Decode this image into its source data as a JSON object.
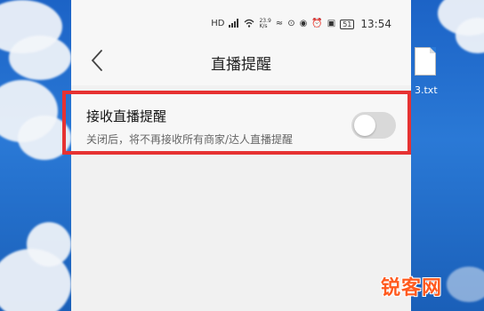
{
  "statusbar": {
    "icons": [
      "hd-icon",
      "signal-icon",
      "wifi-icon",
      "speed-icon",
      "nfc-icon",
      "screen-icon",
      "eye-icon",
      "alarm-icon",
      "battery-icon"
    ],
    "network_speed": "23.9\nK/s",
    "battery_level": "51",
    "time": "13:54"
  },
  "header": {
    "back_icon": "chevron-left-icon",
    "title": "直播提醒"
  },
  "setting": {
    "title": "接收直播提醒",
    "description": "关闭后，将不再接收所有商家/达人直播提醒",
    "toggle_on": false
  },
  "desktop": {
    "file_label": "3.txt"
  },
  "watermark": "锐客网",
  "colors": {
    "highlight": "#e63232",
    "desktop_bg": "#2a79d6",
    "watermark": "#ff5a1f",
    "toggle_off": "#d9d9d9"
  }
}
